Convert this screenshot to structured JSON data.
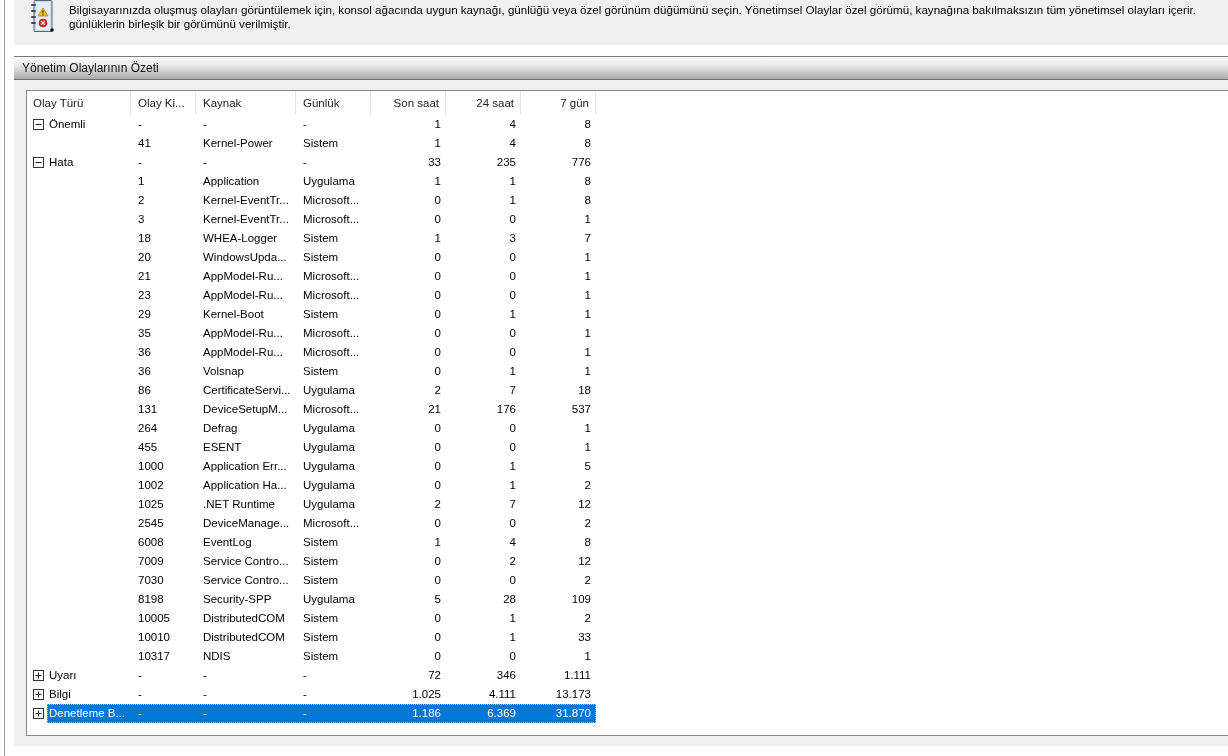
{
  "intro": {
    "text": "Bilgisayarınızda oluşmuş olayları görüntülemek için, konsol ağacında uygun kaynağı, günlüğü veya özel görünüm düğümünü seçin. Yönetimsel Olaylar özel görümü, kaynağına bakılmaksızın tüm yönetimsel olayları içerir. günlüklerin birleşik bir görümünü verilmiştir."
  },
  "section": {
    "title": "Yönetim Olaylarının Özeti"
  },
  "table": {
    "columns": [
      "Olay Türü",
      "Olay Ki...",
      "Kaynak",
      "Günlük",
      "Son saat",
      "24 saat",
      "7 gün"
    ],
    "rows": [
      {
        "cells": [
          "Önemli",
          "-",
          "-",
          "-",
          "1",
          "4",
          "8"
        ],
        "expanded": true,
        "selected": false,
        "children": [
          {
            "cells": [
              "",
              "41",
              "Kernel-Power",
              "Sistem",
              "1",
              "4",
              "8"
            ],
            "selected": false
          }
        ]
      },
      {
        "cells": [
          "Hata",
          "-",
          "-",
          "-",
          "33",
          "235",
          "776"
        ],
        "expanded": true,
        "selected": false,
        "children": [
          {
            "cells": [
              "",
              "1",
              "Application",
              "Uygulama",
              "1",
              "1",
              "8"
            ],
            "selected": false
          },
          {
            "cells": [
              "",
              "2",
              "Kernel-EventTr...",
              "Microsoft...",
              "0",
              "1",
              "8"
            ],
            "selected": false
          },
          {
            "cells": [
              "",
              "3",
              "Kernel-EventTr...",
              "Microsoft...",
              "0",
              "0",
              "1"
            ],
            "selected": false
          },
          {
            "cells": [
              "",
              "18",
              "WHEA-Logger",
              "Sistem",
              "1",
              "3",
              "7"
            ],
            "selected": false
          },
          {
            "cells": [
              "",
              "20",
              "WindowsUpda...",
              "Sistem",
              "0",
              "0",
              "1"
            ],
            "selected": false
          },
          {
            "cells": [
              "",
              "21",
              "AppModel-Ru...",
              "Microsoft...",
              "0",
              "0",
              "1"
            ],
            "selected": false
          },
          {
            "cells": [
              "",
              "23",
              "AppModel-Ru...",
              "Microsoft...",
              "0",
              "0",
              "1"
            ],
            "selected": false
          },
          {
            "cells": [
              "",
              "29",
              "Kernel-Boot",
              "Sistem",
              "0",
              "1",
              "1"
            ],
            "selected": false
          },
          {
            "cells": [
              "",
              "35",
              "AppModel-Ru...",
              "Microsoft...",
              "0",
              "0",
              "1"
            ],
            "selected": false
          },
          {
            "cells": [
              "",
              "36",
              "AppModel-Ru...",
              "Microsoft...",
              "0",
              "0",
              "1"
            ],
            "selected": false
          },
          {
            "cells": [
              "",
              "36",
              "Volsnap",
              "Sistem",
              "0",
              "1",
              "1"
            ],
            "selected": false
          },
          {
            "cells": [
              "",
              "86",
              "CertificateServi...",
              "Uygulama",
              "2",
              "7",
              "18"
            ],
            "selected": false
          },
          {
            "cells": [
              "",
              "131",
              "DeviceSetupM...",
              "Microsoft...",
              "21",
              "176",
              "537"
            ],
            "selected": false
          },
          {
            "cells": [
              "",
              "264",
              "Defrag",
              "Uygulama",
              "0",
              "0",
              "1"
            ],
            "selected": false
          },
          {
            "cells": [
              "",
              "455",
              "ESENT",
              "Uygulama",
              "0",
              "0",
              "1"
            ],
            "selected": false
          },
          {
            "cells": [
              "",
              "1000",
              "Application Err...",
              "Uygulama",
              "0",
              "1",
              "5"
            ],
            "selected": false
          },
          {
            "cells": [
              "",
              "1002",
              "Application Ha...",
              "Uygulama",
              "0",
              "1",
              "2"
            ],
            "selected": false
          },
          {
            "cells": [
              "",
              "1025",
              ".NET Runtime",
              "Uygulama",
              "2",
              "7",
              "12"
            ],
            "selected": false
          },
          {
            "cells": [
              "",
              "2545",
              "DeviceManage...",
              "Microsoft...",
              "0",
              "0",
              "2"
            ],
            "selected": false
          },
          {
            "cells": [
              "",
              "6008",
              "EventLog",
              "Sistem",
              "1",
              "4",
              "8"
            ],
            "selected": false
          },
          {
            "cells": [
              "",
              "7009",
              "Service Contro...",
              "Sistem",
              "0",
              "2",
              "12"
            ],
            "selected": false
          },
          {
            "cells": [
              "",
              "7030",
              "Service Contro...",
              "Sistem",
              "0",
              "0",
              "2"
            ],
            "selected": false
          },
          {
            "cells": [
              "",
              "8198",
              "Security-SPP",
              "Uygulama",
              "5",
              "28",
              "109"
            ],
            "selected": false
          },
          {
            "cells": [
              "",
              "10005",
              "DistributedCOM",
              "Sistem",
              "0",
              "1",
              "2"
            ],
            "selected": false
          },
          {
            "cells": [
              "",
              "10010",
              "DistributedCOM",
              "Sistem",
              "0",
              "1",
              "33"
            ],
            "selected": false
          },
          {
            "cells": [
              "",
              "10317",
              "NDIS",
              "Sistem",
              "0",
              "0",
              "1"
            ],
            "selected": false
          }
        ]
      },
      {
        "cells": [
          "Uyarı",
          "-",
          "-",
          "-",
          "72",
          "346",
          "1.111"
        ],
        "expanded": false,
        "selected": false
      },
      {
        "cells": [
          "Bilgi",
          "-",
          "-",
          "-",
          "1.025",
          "4.111",
          "13.173"
        ],
        "expanded": false,
        "selected": false
      },
      {
        "cells": [
          "Denetleme B...",
          "-",
          "-",
          "-",
          "1.186",
          "6.369",
          "31.870"
        ],
        "expanded": false,
        "selected": true
      }
    ]
  }
}
